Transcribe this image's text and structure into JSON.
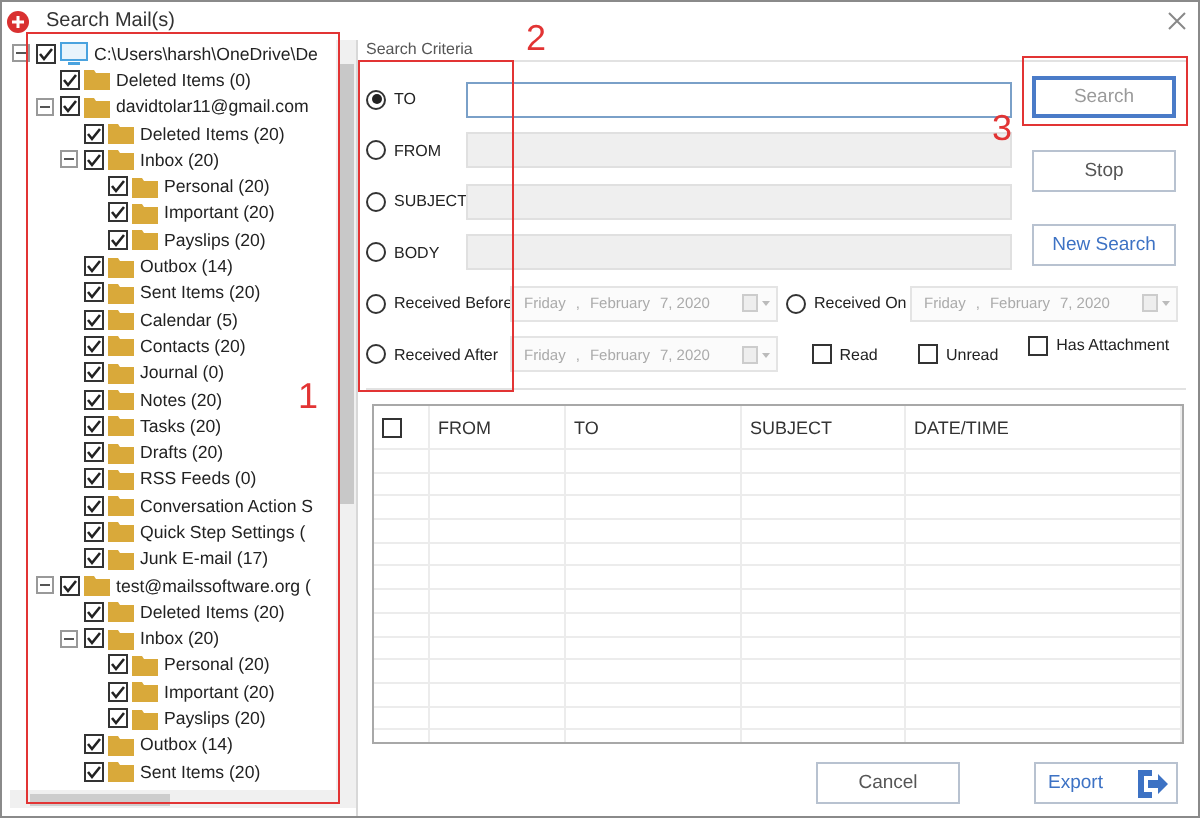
{
  "window": {
    "title": "Search Mail(s)"
  },
  "tree": {
    "items": [
      {
        "label": "C:\\Users\\harsh\\OneDrive\\De",
        "kind": "computer",
        "checked": true,
        "expanded": true,
        "children": [
          {
            "label": "Deleted Items (0)",
            "kind": "folder",
            "checked": true
          },
          {
            "label": "davidtolar11@gmail.com",
            "kind": "folder",
            "checked": true,
            "expanded": true,
            "children": [
              {
                "label": "Deleted Items (20)",
                "kind": "folder",
                "checked": true
              },
              {
                "label": "Inbox (20)",
                "kind": "folder",
                "checked": true,
                "expanded": true,
                "children": [
                  {
                    "label": "Personal (20)",
                    "kind": "folder",
                    "checked": true
                  },
                  {
                    "label": "Important (20)",
                    "kind": "folder",
                    "checked": true
                  },
                  {
                    "label": "Payslips (20)",
                    "kind": "folder",
                    "checked": true
                  }
                ]
              },
              {
                "label": "Outbox (14)",
                "kind": "folder",
                "checked": true
              },
              {
                "label": "Sent Items (20)",
                "kind": "folder",
                "checked": true
              },
              {
                "label": "Calendar (5)",
                "kind": "folder",
                "checked": true
              },
              {
                "label": "Contacts (20)",
                "kind": "folder",
                "checked": true
              },
              {
                "label": "Journal (0)",
                "kind": "folder",
                "checked": true
              },
              {
                "label": "Notes (20)",
                "kind": "folder",
                "checked": true
              },
              {
                "label": "Tasks (20)",
                "kind": "folder",
                "checked": true
              },
              {
                "label": "Drafts (20)",
                "kind": "folder",
                "checked": true
              },
              {
                "label": "RSS Feeds (0)",
                "kind": "folder",
                "checked": true
              },
              {
                "label": "Conversation Action S",
                "kind": "folder",
                "checked": true
              },
              {
                "label": "Quick Step Settings (",
                "kind": "folder",
                "checked": true
              },
              {
                "label": "Junk E-mail (17)",
                "kind": "folder",
                "checked": true
              }
            ]
          },
          {
            "label": "test@mailssoftware.org (",
            "kind": "folder",
            "checked": true,
            "expanded": true,
            "children": [
              {
                "label": "Deleted Items (20)",
                "kind": "folder",
                "checked": true
              },
              {
                "label": "Inbox (20)",
                "kind": "folder",
                "checked": true,
                "expanded": true,
                "children": [
                  {
                    "label": "Personal (20)",
                    "kind": "folder",
                    "checked": true
                  },
                  {
                    "label": "Important (20)",
                    "kind": "folder",
                    "checked": true
                  },
                  {
                    "label": "Payslips (20)",
                    "kind": "folder",
                    "checked": true
                  }
                ]
              },
              {
                "label": "Outbox (14)",
                "kind": "folder",
                "checked": true
              },
              {
                "label": "Sent Items (20)",
                "kind": "folder",
                "checked": true
              }
            ]
          }
        ]
      }
    ]
  },
  "criteria": {
    "title": "Search Criteria",
    "fields": [
      {
        "label": "TO",
        "selected": true,
        "disabled": false
      },
      {
        "label": "FROM",
        "selected": false,
        "disabled": true
      },
      {
        "label": "SUBJECT",
        "selected": false,
        "disabled": true
      },
      {
        "label": "BODY",
        "selected": false,
        "disabled": true
      }
    ],
    "dates": [
      {
        "label": "Received Before",
        "selected": false,
        "picker": [
          "Friday",
          ",",
          "February",
          "7, 2020"
        ]
      },
      {
        "label": "Received After",
        "selected": false,
        "picker": [
          "Friday",
          ",",
          "February",
          "7, 2020"
        ]
      },
      {
        "label": "Received On",
        "selected": false,
        "picker": [
          "Friday",
          ",",
          "February",
          "7, 2020"
        ]
      }
    ],
    "flags": [
      {
        "label": "Read",
        "checked": false
      },
      {
        "label": "Unread",
        "checked": false
      },
      {
        "label": "Has Attachment",
        "checked": false
      }
    ],
    "buttons": [
      {
        "label": "Search",
        "kind": "outlined"
      },
      {
        "label": "Stop",
        "kind": "plain"
      },
      {
        "label": "New Search",
        "kind": "accent"
      }
    ]
  },
  "table": {
    "select_all": false,
    "columns": [
      "FROM",
      "TO",
      "SUBJECT",
      "DATE/TIME"
    ]
  },
  "footer": {
    "buttons": [
      {
        "label": "Cancel",
        "kind": "plain"
      },
      {
        "label": "Export",
        "kind": "export"
      }
    ]
  },
  "annotations": [
    {
      "label": "1"
    },
    {
      "label": "2"
    },
    {
      "label": "3"
    }
  ]
}
